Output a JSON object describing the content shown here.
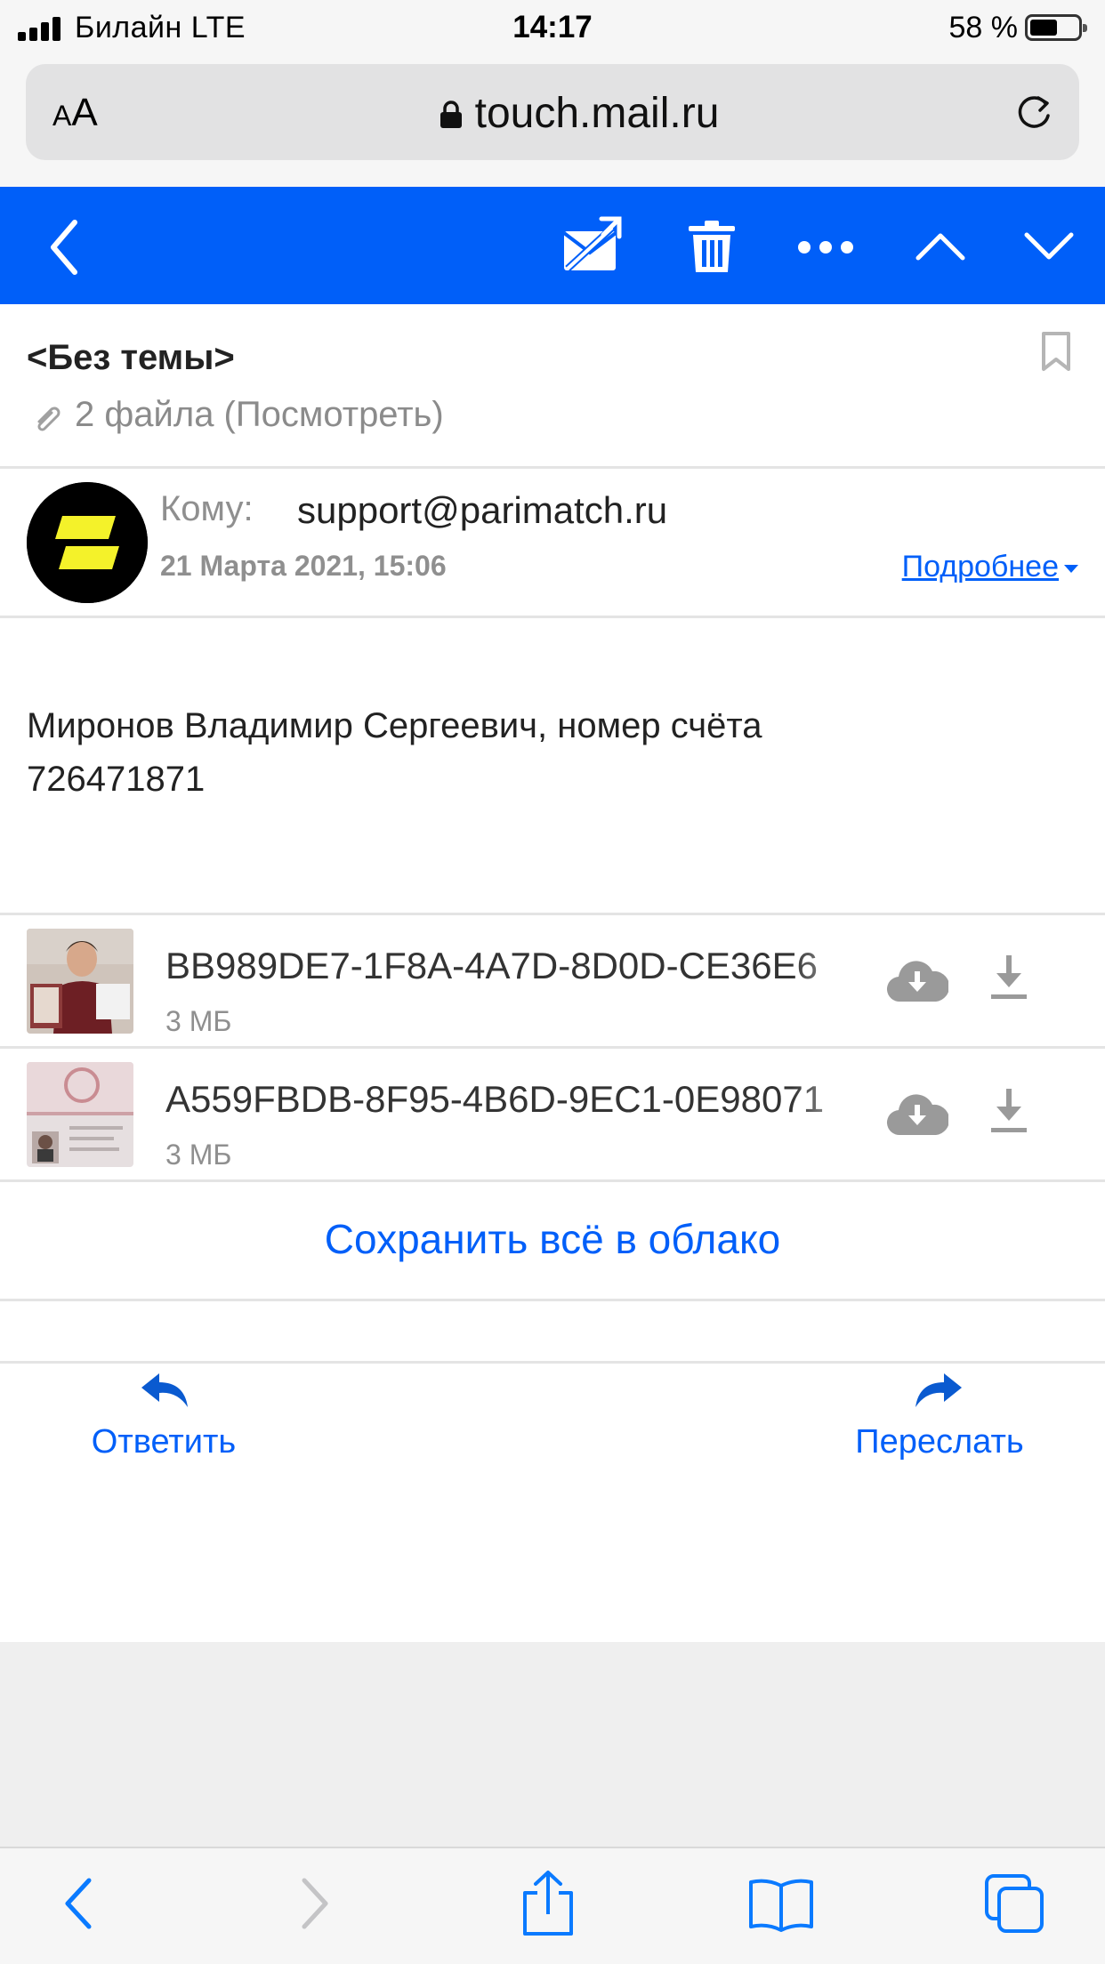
{
  "status_bar": {
    "carrier": "Билайн  LTE",
    "time": "14:17",
    "battery_percent": "58 %",
    "battery_level": 0.58
  },
  "browser": {
    "text_size_label_small": "A",
    "text_size_label_large": "A",
    "url": "touch.mail.ru"
  },
  "toolbar": {
    "icons": [
      "back-chevron-icon",
      "spam-mail-icon",
      "trash-icon",
      "more-dots-icon",
      "chevron-up-icon",
      "chevron-down-icon"
    ],
    "accent_color": "#005ff9"
  },
  "message": {
    "subject": "<Без темы>",
    "attachments_summary": "2 файла (Посмотреть)",
    "to_label": "Кому:",
    "to_address": "support@parimatch.ru",
    "date": "21 Марта 2021, 15:06",
    "details_link": "Подробнее",
    "body_line1": "Миронов Владимир Сергеевич, номер счёта",
    "body_line2": "726471871"
  },
  "attachments": [
    {
      "name": "BB989DE7-1F8A-4A7D-8D0D-CE36E6",
      "size": "3 МБ"
    },
    {
      "name": "A559FBDB-8F95-4B6D-9EC1-0E98071",
      "size": "3 МБ"
    }
  ],
  "save_all_label": "Сохранить всё в облако",
  "actions": {
    "reply": "Ответить",
    "forward": "Переслать"
  },
  "safari_bar": {
    "icons": [
      "back-icon",
      "forward-icon",
      "share-icon",
      "bookmarks-icon",
      "tabs-icon"
    ]
  }
}
